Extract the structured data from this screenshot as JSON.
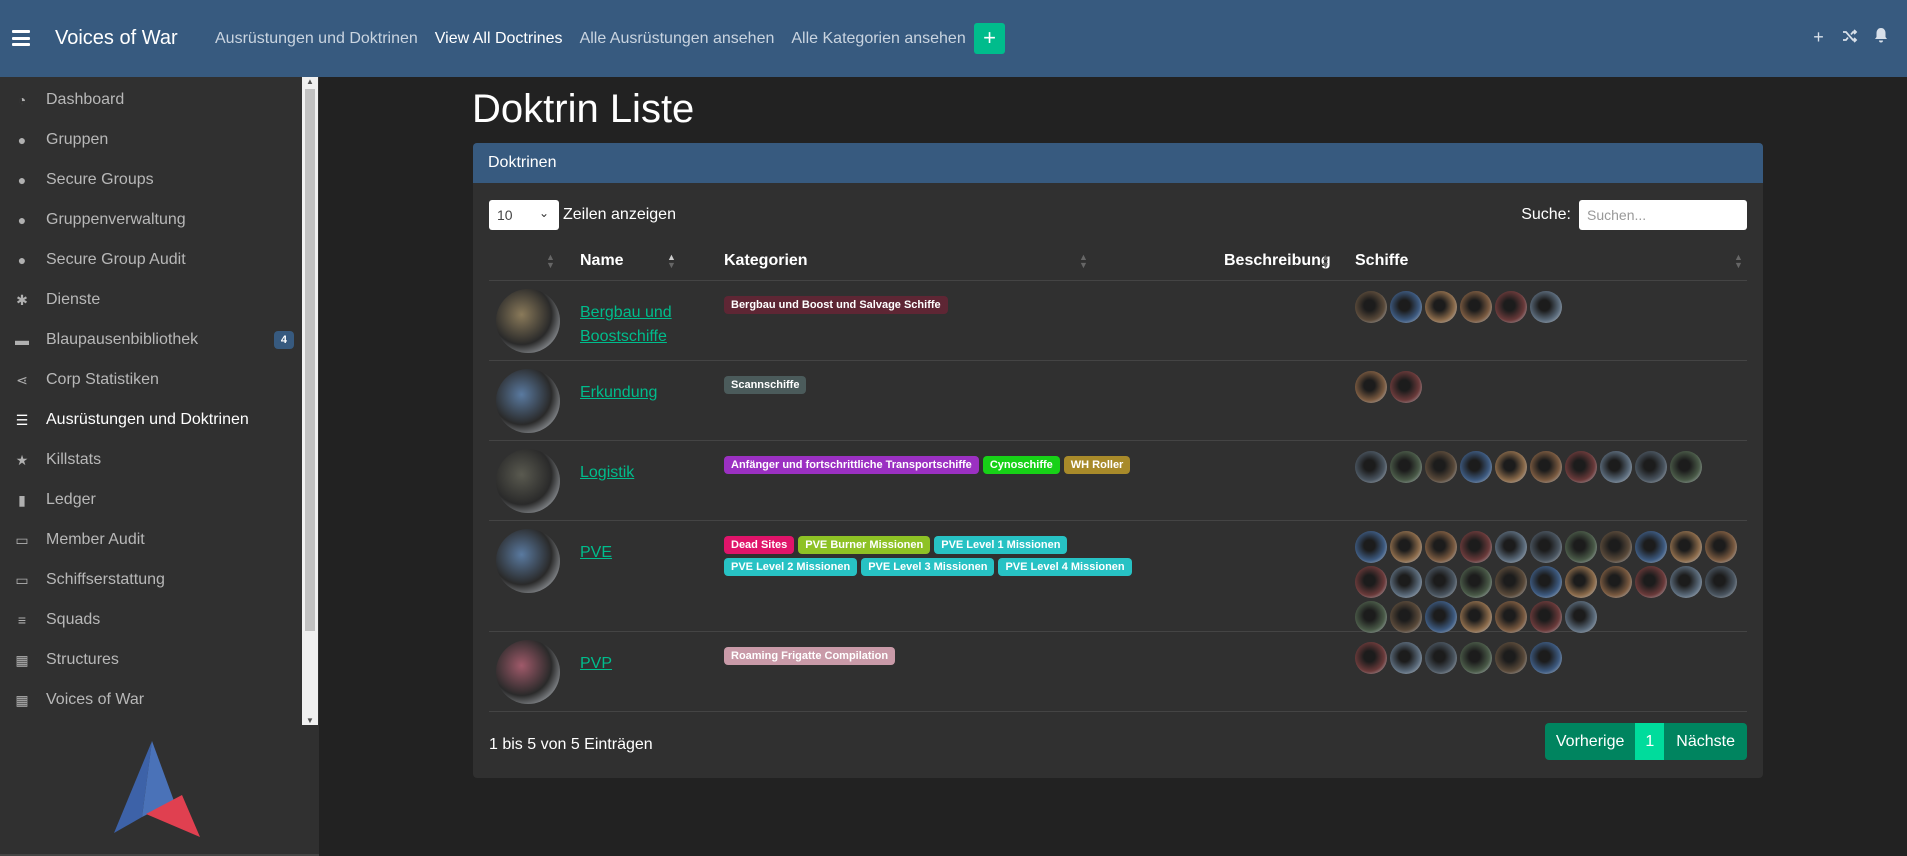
{
  "brand": "Voices of War",
  "topnav": [
    "Ausrüstungen und Doktrinen",
    "View All Doctrines",
    "Alle Ausrüstungen ansehen",
    "Alle Kategorien ansehen"
  ],
  "topnav_add_label": "+",
  "sidebar": [
    {
      "label": "Dashboard",
      "icon": "dashboard-icon"
    },
    {
      "label": "Gruppen",
      "icon": "user-icon"
    },
    {
      "label": "Secure Groups",
      "icon": "user-lock-icon"
    },
    {
      "label": "Gruppenverwaltung",
      "icon": "users-icon"
    },
    {
      "label": "Secure Group Audit",
      "icon": "user-check-icon"
    },
    {
      "label": "Dienste",
      "icon": "cogs-icon"
    },
    {
      "label": "Blaupausenbibliothek",
      "icon": "scroll-icon",
      "badge": "4"
    },
    {
      "label": "Corp Statistiken",
      "icon": "share-nodes-icon"
    },
    {
      "label": "Ausrüstungen und Doktrinen",
      "icon": "list-icon",
      "active": true
    },
    {
      "label": "Killstats",
      "icon": "star-icon"
    },
    {
      "label": "Ledger",
      "icon": "book-icon"
    },
    {
      "label": "Member Audit",
      "icon": "id-card-icon"
    },
    {
      "label": "Schiffserstattung",
      "icon": "money-bill-icon"
    },
    {
      "label": "Squads",
      "icon": "people-group-icon"
    },
    {
      "label": "Structures",
      "icon": "building-icon"
    },
    {
      "label": "Voices of War",
      "icon": "building-icon"
    }
  ],
  "page_title": "Doktrin Liste",
  "card_title": "Doktrinen",
  "length": {
    "value": "10",
    "label": "Zeilen anzeigen"
  },
  "search": {
    "label": "Suche:",
    "placeholder": "Suchen..."
  },
  "columns": [
    "Name",
    "Kategorien",
    "Beschreibung",
    "Schiffe"
  ],
  "rows": [
    {
      "name": "Bergbau und Boostschiffe",
      "tags": [
        {
          "text": "Bergbau und Boost und Salvage Schiffe",
          "color": "#5e2634"
        }
      ],
      "ships": 6
    },
    {
      "name": "Erkundung",
      "tags": [
        {
          "text": "Scannschiffe",
          "color": "#4b5b5b"
        }
      ],
      "ships": 2
    },
    {
      "name": "Logistik",
      "tags": [
        {
          "text": "Anfänger und fortschrittliche Transportschiffe",
          "color": "#9b30c2"
        },
        {
          "text": "Cynoschiffe",
          "color": "#17d117"
        },
        {
          "text": "WH Roller",
          "color": "#a88a2a"
        }
      ],
      "ships": 10
    },
    {
      "name": "PVE",
      "tags": [
        {
          "text": "Dead Sites",
          "color": "#e0146a"
        },
        {
          "text": "PVE Burner Missionen",
          "color": "#8ec225"
        },
        {
          "text": "PVE Level 1 Missionen",
          "color": "#27c2c4"
        },
        {
          "text": "PVE Level 2 Missionen",
          "color": "#27c2c4"
        },
        {
          "text": "PVE Level 3 Missionen",
          "color": "#27c2c4"
        },
        {
          "text": "PVE Level 4 Missionen",
          "color": "#27c2c4"
        }
      ],
      "ships": 29
    },
    {
      "name": "PVP",
      "tags": [
        {
          "text": "Roaming Frigatte Compilation",
          "color": "#c99aa8"
        }
      ],
      "ships": 6
    }
  ],
  "info": "1 bis 5 von 5 Einträgen",
  "pager": {
    "prev": "Vorherige",
    "current": "1",
    "next": "Nächste"
  }
}
